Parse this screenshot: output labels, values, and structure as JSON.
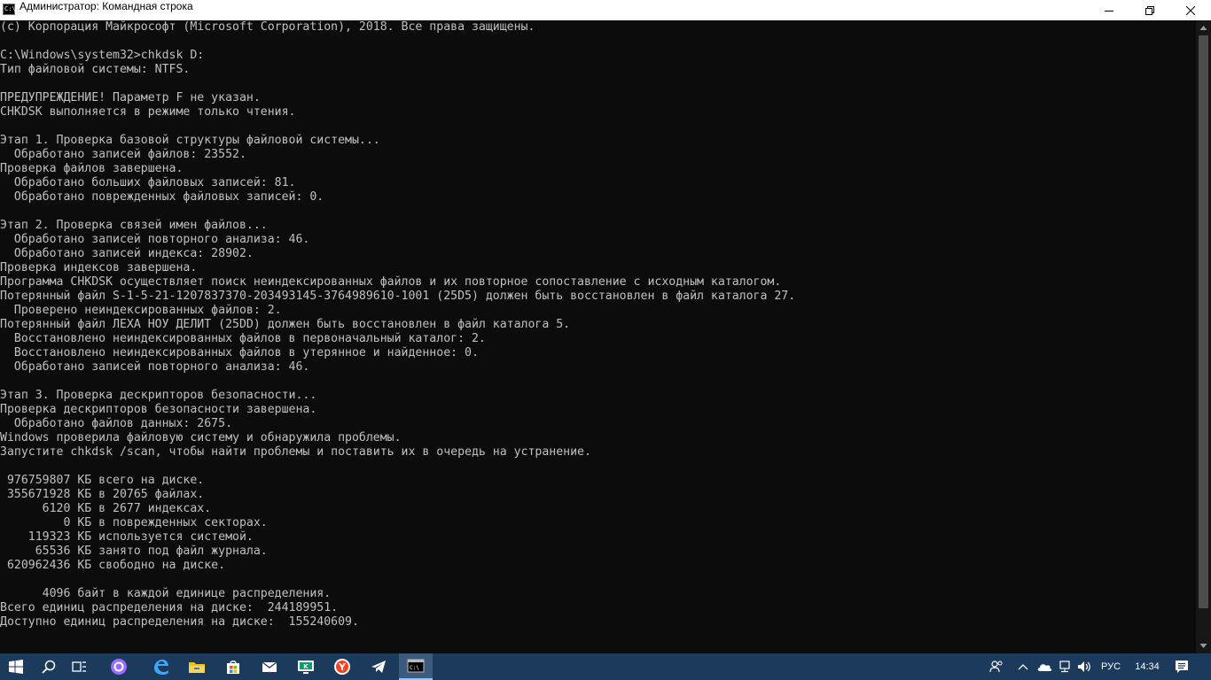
{
  "window": {
    "title": "Администратор: Командная строка",
    "icon_text": "C:\\"
  },
  "console": {
    "lines": [
      "(c) Корпорация Майкрософт (Microsoft Corporation), 2018. Все права защищены.",
      "",
      "C:\\Windows\\system32>chkdsk D:",
      "Тип файловой системы: NTFS.",
      "",
      "ПРЕДУПРЕЖДЕНИЕ! Параметр F не указан.",
      "CHKDSK выполняется в режиме только чтения.",
      "",
      "Этап 1. Проверка базовой структуры файловой системы...",
      "  Обработано записей файлов: 23552.",
      "Проверка файлов завершена.",
      "  Обработано больших файловых записей: 81.",
      "  Обработано поврежденных файловых записей: 0.",
      "",
      "Этап 2. Проверка связей имен файлов...",
      "  Обработано записей повторного анализа: 46.",
      "  Обработано записей индекса: 28902.",
      "Проверка индексов завершена.",
      "Программа CHKDSK осуществляет поиск неиндексированных файлов и их повторное сопоставление с исходным каталогом.",
      "Потерянный файл S-1-5-21-1207837370-203493145-3764989610-1001 (25D5) должен быть восстановлен в файл каталога 27.",
      "  Проверено неиндексированных файлов: 2.",
      "Потерянный файл ЛЕХА НОУ ДЕЛИТ (25DD) должен быть восстановлен в файл каталога 5.",
      "  Восстановлено неиндексированных файлов в первоначальный каталог: 2.",
      "  Восстановлено неиндексированных файлов в утерянное и найденное: 0.",
      "  Обработано записей повторного анализа: 46.",
      "",
      "Этап 3. Проверка дескрипторов безопасности...",
      "Проверка дескрипторов безопасности завершена.",
      "  Обработано файлов данных: 2675.",
      "Windows проверила файловую систему и обнаружила проблемы.",
      "Запустите chkdsk /scan, чтобы найти проблемы и поставить их в очередь на устранение.",
      "",
      " 976759807 КБ всего на диске.",
      " 355671928 КБ в 20765 файлах.",
      "      6120 КБ в 2677 индексах.",
      "         0 КБ в поврежденных секторах.",
      "    119323 КБ используется системой.",
      "     65536 КБ занято под файл журнала.",
      " 620962436 КБ свободно на диске.",
      "",
      "      4096 байт в каждой единице распределения.",
      "Всего единиц распределения на диске:  244189951.",
      "Доступно единиц распределения на диске:  155240609."
    ]
  },
  "scrollbar": {
    "position_fraction": 0.0,
    "visible_fraction": 0.95
  },
  "taskbar": {
    "pinned": [
      "windows-start-icon",
      "search-icon",
      "task-view-icon",
      "cortana-icon",
      "edge-icon",
      "file-explorer-icon",
      "store-icon",
      "mail-icon",
      "kaspersky-icon",
      "yandex-browser-icon",
      "telegram-icon",
      "cmd-icon"
    ],
    "tray": {
      "language": "РУС",
      "time": "14:34"
    }
  },
  "colors": {
    "console_bg": "#0c0c0c",
    "console_text": "#c0c0c0",
    "taskbar_bg": "#1c3a5b",
    "titlebar_bg": "#ffffff"
  }
}
